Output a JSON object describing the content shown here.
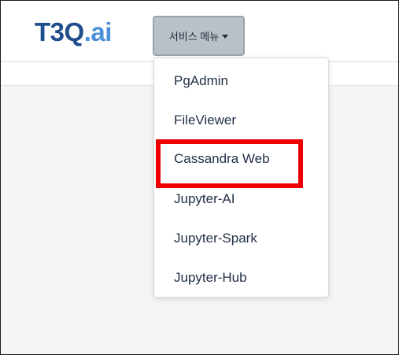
{
  "header": {
    "logo": {
      "main": "T3Q",
      "suffix": ".ai"
    },
    "service_menu": {
      "label": "서비스 메뉴"
    }
  },
  "dropdown": {
    "items": [
      {
        "label": "PgAdmin"
      },
      {
        "label": "FileViewer"
      },
      {
        "label": "Cassandra Web"
      },
      {
        "label": "Jupyter-AI"
      },
      {
        "label": "Jupyter-Spark"
      },
      {
        "label": "Jupyter-Hub"
      }
    ]
  },
  "colors": {
    "logo_main": "#1f4e8c",
    "logo_accent": "#4a90d9",
    "menu_button_bg": "#b8c0c8",
    "highlight": "#ee0000",
    "item_text": "#223047"
  }
}
